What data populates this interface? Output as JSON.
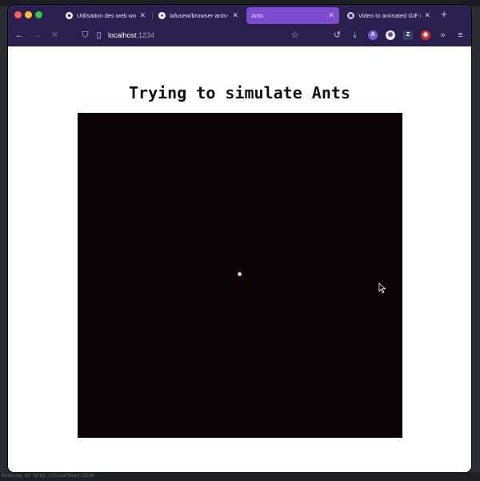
{
  "browser": {
    "tabs": [
      {
        "label": "Utilisation des web worke",
        "icon": "mdn-icon",
        "active": false
      },
      {
        "label": "lafusew/browser-ants-sir",
        "icon": "github-icon",
        "active": false
      },
      {
        "label": "Ants",
        "icon": "",
        "active": true
      },
      {
        "label": "Video to animated GIF co",
        "icon": "converter-icon",
        "active": false
      }
    ],
    "url": {
      "host": "localhost",
      "port": ":1234"
    },
    "colors": {
      "chrome": "#2b1f4f",
      "active_tab": "#7b4bd0"
    }
  },
  "page": {
    "title": "Trying to simulate Ants",
    "canvas_color": "#0d0208",
    "ant_color": "#e8d489"
  },
  "terminal": {
    "bottom_text": "Running at http://localhost:1234"
  }
}
